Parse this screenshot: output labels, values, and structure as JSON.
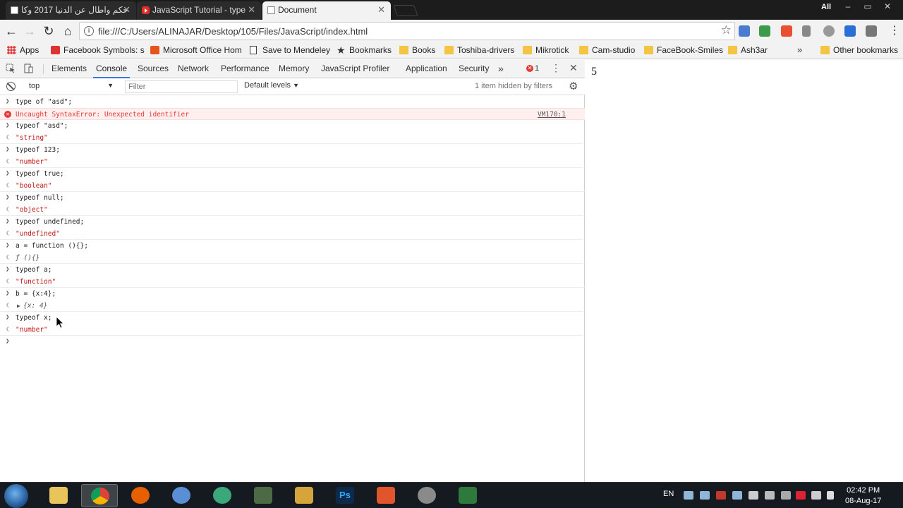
{
  "tabs": [
    {
      "title": "حكم واطال عن الدنيا 2017 وكا",
      "icon": "page-icon"
    },
    {
      "title": "JavaScript Tutorial - type",
      "icon": "youtube-icon"
    },
    {
      "title": "Document",
      "icon": "page-icon",
      "active": true
    }
  ],
  "window": {
    "user_badge": "All"
  },
  "toolbar": {
    "url": "file:///C:/Users/ALINAJAR/Desktop/105/Files/JavaScript/index.html"
  },
  "bookmarks": [
    {
      "label": "Apps",
      "icon": "apps-icon"
    },
    {
      "label": "Facebook Symbols: s",
      "icon": "facebook-symbols-icon"
    },
    {
      "label": "Microsoft Office Hom",
      "icon": "office-icon"
    },
    {
      "label": "Save to Mendeley",
      "icon": "page-icon"
    },
    {
      "label": "Bookmarks",
      "icon": "star-icon"
    },
    {
      "label": "Books",
      "icon": "folder-icon"
    },
    {
      "label": "Toshiba-drivers",
      "icon": "folder-icon"
    },
    {
      "label": "Mikrotick",
      "icon": "folder-icon"
    },
    {
      "label": "Cam-studio",
      "icon": "folder-icon"
    },
    {
      "label": "FaceBook-Smiles",
      "icon": "folder-icon"
    },
    {
      "label": "Ash3ar",
      "icon": "folder-icon"
    },
    {
      "label": "Other bookmarks",
      "icon": "folder-icon"
    }
  ],
  "devtools": {
    "tabs": [
      "Elements",
      "Console",
      "Sources",
      "Network",
      "Performance",
      "Memory",
      "JavaScript Profiler",
      "Application",
      "Security"
    ],
    "active_tab": "Console",
    "more": "»",
    "error_count": "1",
    "context": "top",
    "filter_placeholder": "Filter",
    "levels": "Default levels",
    "hidden_note": "1 item hidden by filters",
    "console": {
      "rows": [
        {
          "kind": "in",
          "text": "type of \"asd\";"
        },
        {
          "kind": "error",
          "text": "Uncaught SyntaxError: Unexpected identifier",
          "source": "VM170:1"
        },
        {
          "kind": "in",
          "text": "typeof \"asd\";"
        },
        {
          "kind": "out",
          "text": "\"string\""
        },
        {
          "kind": "in",
          "text": "typeof 123;"
        },
        {
          "kind": "out",
          "text": "\"number\""
        },
        {
          "kind": "in",
          "text": "typeof true;"
        },
        {
          "kind": "out",
          "text": "\"boolean\""
        },
        {
          "kind": "in",
          "text": "typeof null;"
        },
        {
          "kind": "out",
          "text": "\"object\""
        },
        {
          "kind": "in",
          "text": "typeof undefined;"
        },
        {
          "kind": "out",
          "text": "\"undefined\""
        },
        {
          "kind": "in",
          "text": "a = function (){};"
        },
        {
          "kind": "out-fn",
          "text": "ƒ (){}"
        },
        {
          "kind": "in",
          "text": "typeof a;"
        },
        {
          "kind": "out",
          "text": "\"function\""
        },
        {
          "kind": "in",
          "text": "b = {x:4};"
        },
        {
          "kind": "out-obj",
          "text": "{x: 4}"
        },
        {
          "kind": "in",
          "text": "typeof x;"
        },
        {
          "kind": "out",
          "text": "\"number\""
        }
      ]
    }
  },
  "page": {
    "output": "5"
  },
  "taskbar": {
    "language": "EN",
    "time": "02:42 PM",
    "date": "08-Aug-17"
  }
}
